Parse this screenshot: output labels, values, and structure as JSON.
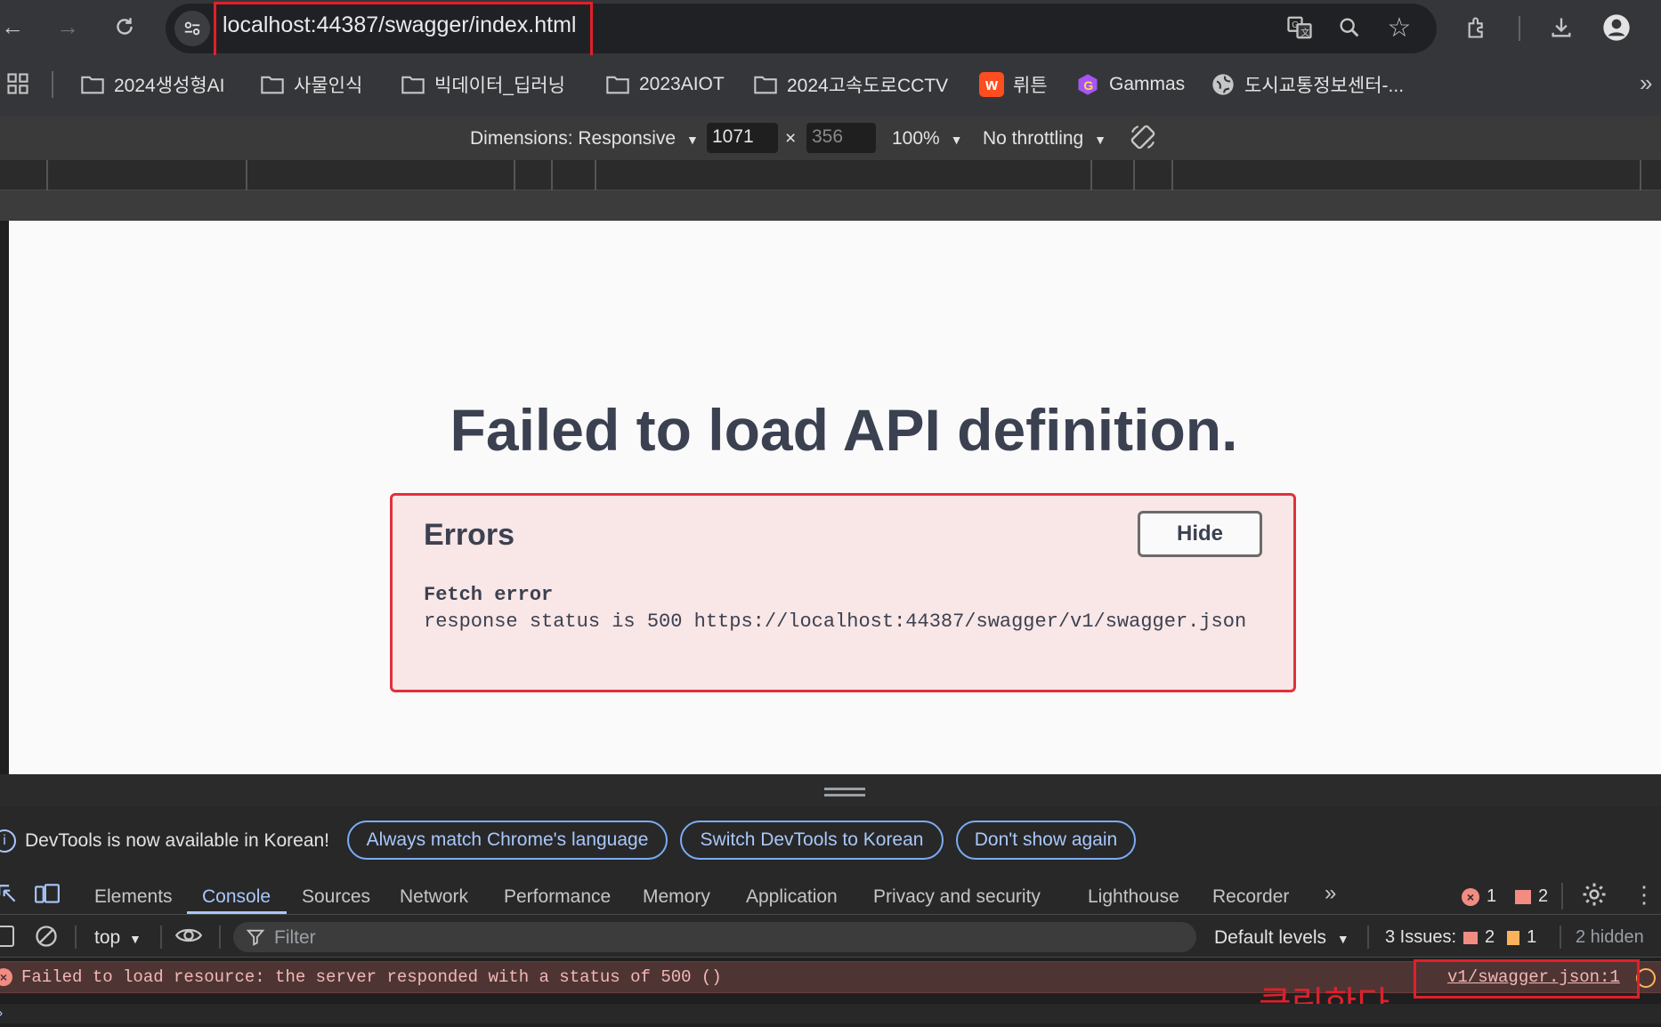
{
  "browser": {
    "url": "localhost:44387/swagger/index.html"
  },
  "bookmarks": [
    {
      "label": "2024생성형AI",
      "icon": "folder-icon"
    },
    {
      "label": "사물인식",
      "icon": "folder-icon"
    },
    {
      "label": "빅데이터_딥러닝",
      "icon": "folder-icon"
    },
    {
      "label": "2023AIOT",
      "icon": "folder-icon"
    },
    {
      "label": "2024고속도로CCTV",
      "icon": "folder-icon"
    },
    {
      "label": "뤼튼",
      "icon": "wrtn-icon"
    },
    {
      "label": "Gammas",
      "icon": "gamma-icon"
    },
    {
      "label": "도시교통정보센터-...",
      "icon": "globe-icon"
    }
  ],
  "device_toolbar": {
    "dimensions_label": "Dimensions: Responsive",
    "width": "1071",
    "height": "356",
    "times": "×",
    "zoom": "100%",
    "throttling": "No throttling"
  },
  "page": {
    "title": "Failed to load API definition.",
    "errors_heading": "Errors",
    "hide_label": "Hide",
    "fetch_title": "Fetch error",
    "fetch_message": "response status is 500 https://localhost:44387/swagger/v1/swagger.json"
  },
  "notice": {
    "text": "DevTools is now available in Korean!",
    "buttons": [
      "Always match Chrome's language",
      "Switch DevTools to Korean",
      "Don't show again"
    ]
  },
  "devtools": {
    "tabs": [
      "Elements",
      "Console",
      "Sources",
      "Network",
      "Performance",
      "Memory",
      "Application",
      "Privacy and security",
      "Lighthouse",
      "Recorder"
    ],
    "error_count": "1",
    "warning_count": "2",
    "context": "top",
    "filter_placeholder": "Filter",
    "levels": "Default levels",
    "issues_label": "3 Issues:",
    "issues_errors": "2",
    "issues_warnings": "1",
    "hidden": "2 hidden"
  },
  "console": {
    "error_message": "Failed to load resource: the server responded with a status of 500 ()",
    "source_link": "v1/swagger.json:1"
  },
  "annotation": {
    "text": "클릭한다"
  },
  "colors": {
    "highlight": "#e0202a",
    "swagger_error_border": "#e0313d",
    "console_error_bg": "#4e3534"
  }
}
